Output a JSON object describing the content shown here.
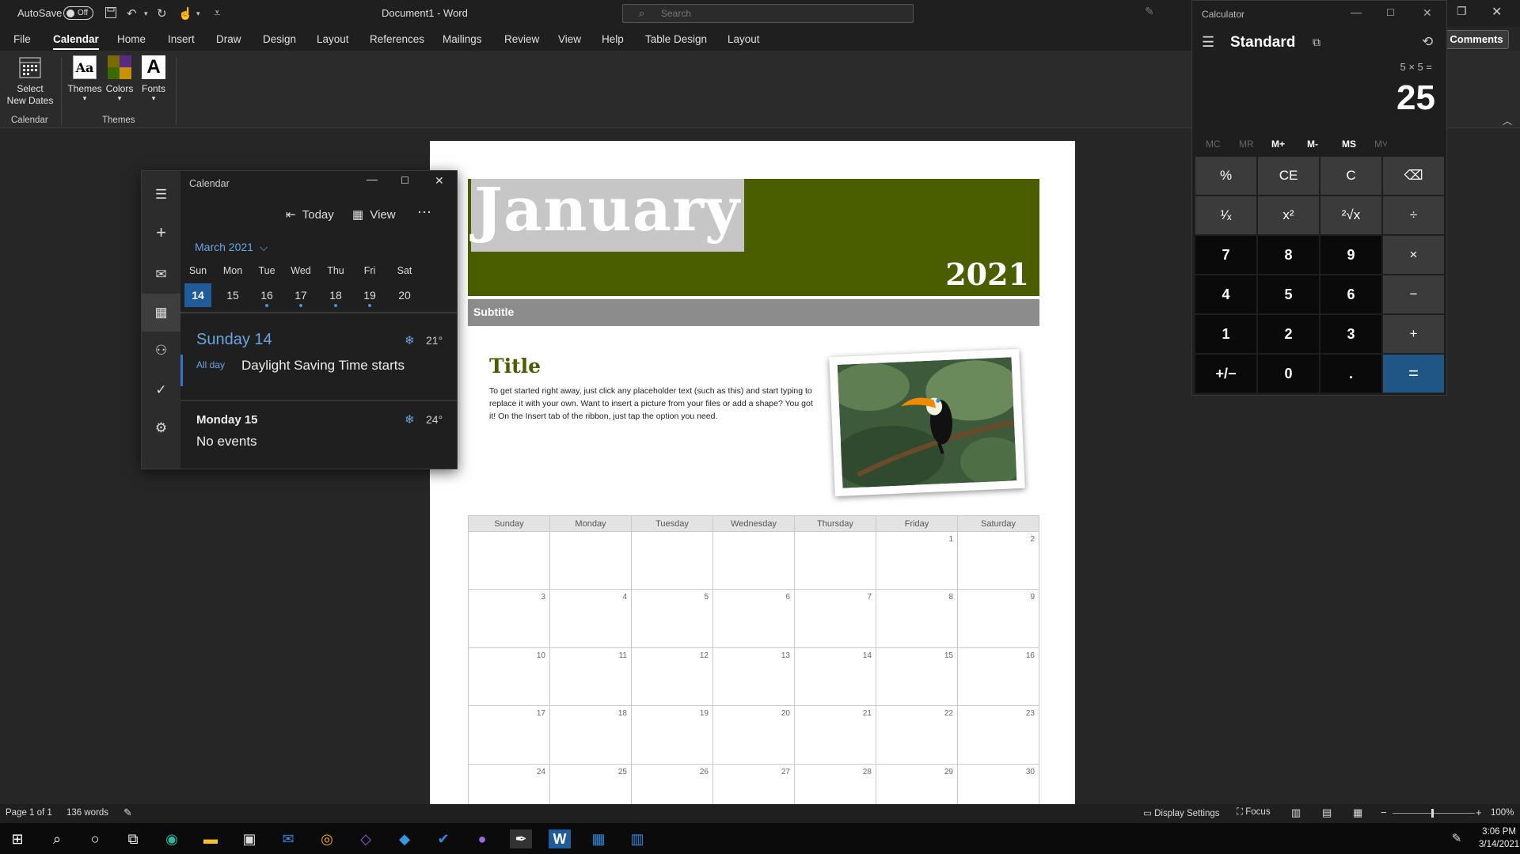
{
  "word": {
    "autosave_label": "AutoSave",
    "autosave_state": "Off",
    "doc_title": "Document1  -  Word",
    "search_placeholder": "Search",
    "tabs": [
      "File",
      "Calendar",
      "Home",
      "Insert",
      "Draw",
      "Design",
      "Layout",
      "References",
      "Mailings",
      "Review",
      "View",
      "Help",
      "Table Design",
      "Layout"
    ],
    "active_tab": "Calendar",
    "comments_label": "Comments",
    "ribbon": {
      "select_dates": "Select New Dates",
      "calendar_group": "Calendar",
      "themes": "Themes",
      "colors": "Colors",
      "fonts": "Fonts",
      "themes_group": "Themes"
    },
    "document": {
      "month": "January",
      "year": "2021",
      "subtitle": "Subtitle",
      "heading": "Title",
      "body": "To get started right away, just click any placeholder text (such as this) and start typing to replace it with your own. Want to insert a picture from your files or add a shape? You got it! On the Insert tab of the ribbon, just tap the option you need.",
      "weekdays": [
        "Sunday",
        "Monday",
        "Tuesday",
        "Wednesday",
        "Thursday",
        "Friday",
        "Saturday"
      ],
      "weeks": [
        [
          "",
          "",
          "",
          "",
          "",
          "1",
          "2"
        ],
        [
          "3",
          "4",
          "5",
          "6",
          "7",
          "8",
          "9"
        ],
        [
          "10",
          "11",
          "12",
          "13",
          "14",
          "15",
          "16"
        ],
        [
          "17",
          "18",
          "19",
          "20",
          "21",
          "22",
          "23"
        ],
        [
          "24",
          "25",
          "26",
          "27",
          "28",
          "29",
          "30"
        ]
      ],
      "colors": {
        "banner": "#4a5e00",
        "subtitle_bar": "#8c8c8c"
      }
    },
    "status": {
      "page": "Page 1 of 1",
      "words": "136 words",
      "display_settings": "Display Settings",
      "focus": "Focus",
      "zoom": "100%"
    }
  },
  "calendar_app": {
    "title": "Calendar",
    "today_label": "Today",
    "view_label": "View",
    "month_label": "March 2021",
    "day_heads": [
      "Sun",
      "Mon",
      "Tue",
      "Wed",
      "Thu",
      "Fri",
      "Sat"
    ],
    "day_nums": [
      "14",
      "15",
      "16",
      "17",
      "18",
      "19",
      "20"
    ],
    "selected_day": "14",
    "agenda": [
      {
        "date": "Sunday 14",
        "temp": "21°",
        "time": "All day",
        "event": "Daylight Saving Time starts"
      },
      {
        "date": "Monday 15",
        "temp": "24°",
        "event": "No events"
      }
    ],
    "accent": "#1f5c99"
  },
  "calculator": {
    "title": "Calculator",
    "mode": "Standard",
    "expression": "5 × 5 =",
    "result": "25",
    "memory": [
      {
        "label": "MC",
        "enabled": false
      },
      {
        "label": "MR",
        "enabled": false
      },
      {
        "label": "M+",
        "enabled": true
      },
      {
        "label": "M-",
        "enabled": true
      },
      {
        "label": "MS",
        "enabled": true
      },
      {
        "label": "M˅",
        "enabled": false
      }
    ],
    "keys": [
      [
        "%",
        "CE",
        "C",
        "⌫"
      ],
      [
        "¹⁄ₓ",
        "x²",
        "²√x",
        "÷"
      ],
      [
        "7",
        "8",
        "9",
        "×"
      ],
      [
        "4",
        "5",
        "6",
        "−"
      ],
      [
        "1",
        "2",
        "3",
        "+"
      ],
      [
        "+/−",
        "0",
        ".",
        "="
      ]
    ],
    "accent": "#1f5686"
  },
  "taskbar": {
    "time": "3:06 PM",
    "date": "3/14/2021"
  }
}
